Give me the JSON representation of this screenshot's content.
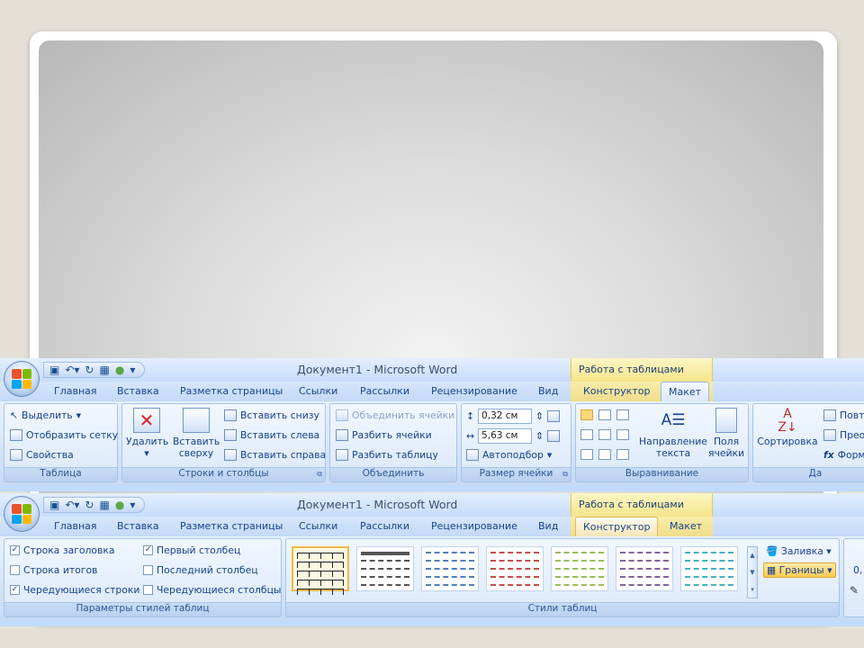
{
  "window_title": "Документ1 - Microsoft Word",
  "context_title": "Работа с таблицами",
  "tabs": [
    "Главная",
    "Вставка",
    "Разметка страницы",
    "Ссылки",
    "Рассылки",
    "Рецензирование",
    "Вид"
  ],
  "ctx_tabs": [
    "Конструктор",
    "Макет"
  ],
  "layout": {
    "groups": {
      "table": {
        "label": "Таблица",
        "items": [
          "Выделить",
          "Отобразить сетку",
          "Свойства"
        ]
      },
      "rows_cols": {
        "label": "Строки и столбцы",
        "delete": "Удалить",
        "insert_above_1": "Вставить",
        "insert_above_2": "сверху",
        "items": [
          "Вставить снизу",
          "Вставить слева",
          "Вставить справа"
        ]
      },
      "merge": {
        "label": "Объединить",
        "items": [
          "Объединить ячейки",
          "Разбить ячейки",
          "Разбить таблицу"
        ]
      },
      "cell_size": {
        "label": "Размер ячейки",
        "height": "0,32 см",
        "width": "5,63 см",
        "autofit": "Автоподбор"
      },
      "alignment": {
        "label": "Выравнивание",
        "text_dir_1": "Направление",
        "text_dir_2": "текста",
        "margins_1": "Поля",
        "margins_2": "ячейки"
      },
      "data": {
        "label": "Да",
        "sort": "Сортировка",
        "items": [
          "Повто",
          "Прео",
          "Форм"
        ]
      }
    }
  },
  "design": {
    "groups": {
      "style_options": {
        "label": "Параметры стилей таблиц",
        "options": [
          {
            "label": "Строка заголовка",
            "checked": true
          },
          {
            "label": "Строка итогов",
            "checked": false
          },
          {
            "label": "Чередующиеся строки",
            "checked": true
          },
          {
            "label": "Первый столбец",
            "checked": true
          },
          {
            "label": "Последний столбец",
            "checked": false
          },
          {
            "label": "Чередующиеся столбцы",
            "checked": false
          }
        ]
      },
      "styles": {
        "label": "Стили таблиц",
        "shading": "Заливка",
        "borders": "Границы",
        "swatch_colors": [
          "#222222",
          "#555555",
          "#4f81bd",
          "#c0504d",
          "#9bbb59",
          "#8064a2",
          "#4bacc6"
        ]
      },
      "cut_value": "0,"
    }
  }
}
